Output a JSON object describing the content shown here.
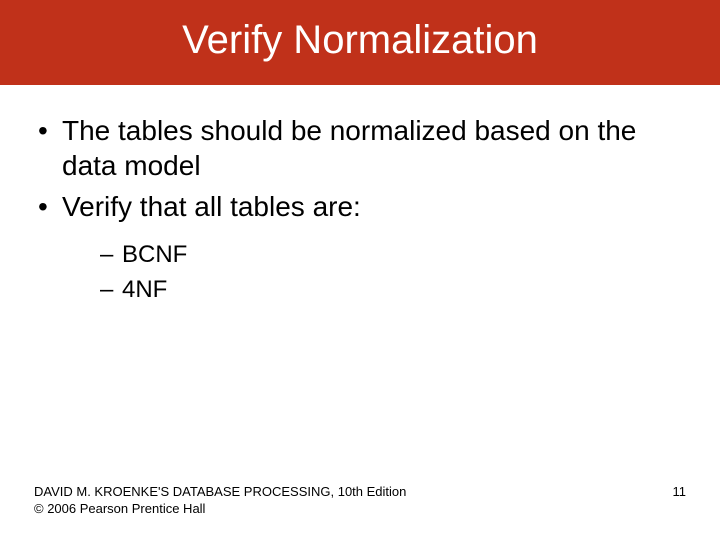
{
  "title": "Verify Normalization",
  "bullets": [
    {
      "text": "The tables should be normalized based on the data model"
    },
    {
      "text": "Verify that all tables are:"
    }
  ],
  "sub_bullets": [
    {
      "text": "BCNF"
    },
    {
      "text": "4NF"
    }
  ],
  "footer": {
    "line1": "DAVID M. KROENKE'S DATABASE PROCESSING, 10th Edition",
    "line2": "© 2006 Pearson Prentice Hall"
  },
  "page_number": "11"
}
